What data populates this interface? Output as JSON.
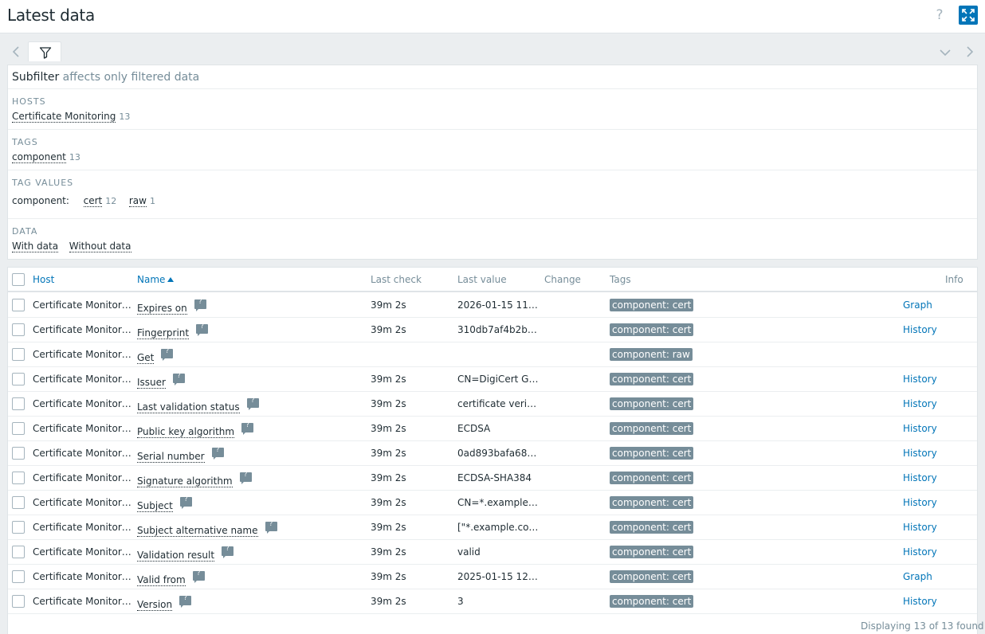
{
  "header": {
    "title": "Latest data",
    "help_glyph": "?"
  },
  "icons": {
    "help": "help-icon",
    "fullscreen": "fullscreen-icon",
    "filter": "filter-icon",
    "nav_left": "chevron-left-icon",
    "nav_right": "chevron-right-icon",
    "collapse": "chevron-down-icon",
    "hint": "hint-icon"
  },
  "colors": {
    "accent": "#0275b8",
    "tag_bg": "#768d99",
    "muted": "#768d99"
  },
  "subfilter": {
    "title": "Subfilter",
    "title_note": "affects only filtered data",
    "hosts": {
      "heading": "HOSTS",
      "items": [
        {
          "label": "Certificate Monitoring",
          "count": "13"
        }
      ]
    },
    "tags": {
      "heading": "TAGS",
      "items": [
        {
          "label": "component",
          "count": "13"
        }
      ]
    },
    "tag_values": {
      "heading": "TAG VALUES",
      "tag_name": "component:",
      "items": [
        {
          "label": "cert",
          "count": "12"
        },
        {
          "label": "raw",
          "count": "1"
        }
      ]
    },
    "data": {
      "heading": "DATA",
      "items": [
        {
          "label": "With data"
        },
        {
          "label": "Without data"
        }
      ]
    }
  },
  "table": {
    "columns": {
      "host": "Host",
      "name": "Name",
      "last_check": "Last check",
      "last_value": "Last value",
      "change": "Change",
      "tags": "Tags",
      "info": "Info"
    },
    "rows": [
      {
        "host": "Certificate Monitoring",
        "name": "Expires on",
        "last_check": "39m 2s",
        "last_value": "2026-01-15 11:5…",
        "change": "",
        "tag": "component: cert",
        "action": "Graph"
      },
      {
        "host": "Certificate Monitoring",
        "name": "Fingerprint",
        "last_check": "39m 2s",
        "last_value": "310db7af4b2bc…",
        "change": "",
        "tag": "component: cert",
        "action": "History"
      },
      {
        "host": "Certificate Monitoring",
        "name": "Get",
        "last_check": "",
        "last_value": "",
        "change": "",
        "tag": "component: raw",
        "action": ""
      },
      {
        "host": "Certificate Monitoring",
        "name": "Issuer",
        "last_check": "39m 2s",
        "last_value": "CN=DigiCert Gl…",
        "change": "",
        "tag": "component: cert",
        "action": "History"
      },
      {
        "host": "Certificate Monitoring",
        "name": "Last validation status",
        "last_check": "39m 2s",
        "last_value": "certificate verifie…",
        "change": "",
        "tag": "component: cert",
        "action": "History"
      },
      {
        "host": "Certificate Monitoring",
        "name": "Public key algorithm",
        "last_check": "39m 2s",
        "last_value": "ECDSA",
        "change": "",
        "tag": "component: cert",
        "action": "History"
      },
      {
        "host": "Certificate Monitoring",
        "name": "Serial number",
        "last_check": "39m 2s",
        "last_value": "0ad893bafa68b…",
        "change": "",
        "tag": "component: cert",
        "action": "History"
      },
      {
        "host": "Certificate Monitoring",
        "name": "Signature algorithm",
        "last_check": "39m 2s",
        "last_value": "ECDSA-SHA384",
        "change": "",
        "tag": "component: cert",
        "action": "History"
      },
      {
        "host": "Certificate Monitoring",
        "name": "Subject",
        "last_check": "39m 2s",
        "last_value": "CN=*.example.c…",
        "change": "",
        "tag": "component: cert",
        "action": "History"
      },
      {
        "host": "Certificate Monitoring",
        "name": "Subject alternative name",
        "last_check": "39m 2s",
        "last_value": "[\"*.example.com…",
        "change": "",
        "tag": "component: cert",
        "action": "History"
      },
      {
        "host": "Certificate Monitoring",
        "name": "Validation result",
        "last_check": "39m 2s",
        "last_value": "valid",
        "change": "",
        "tag": "component: cert",
        "action": "History"
      },
      {
        "host": "Certificate Monitoring",
        "name": "Valid from",
        "last_check": "39m 2s",
        "last_value": "2025-01-15 12:…",
        "change": "",
        "tag": "component: cert",
        "action": "Graph"
      },
      {
        "host": "Certificate Monitoring",
        "name": "Version",
        "last_check": "39m 2s",
        "last_value": "3",
        "change": "",
        "tag": "component: cert",
        "action": "History"
      }
    ]
  },
  "footer": {
    "summary": "Displaying 13 of 13 found"
  }
}
